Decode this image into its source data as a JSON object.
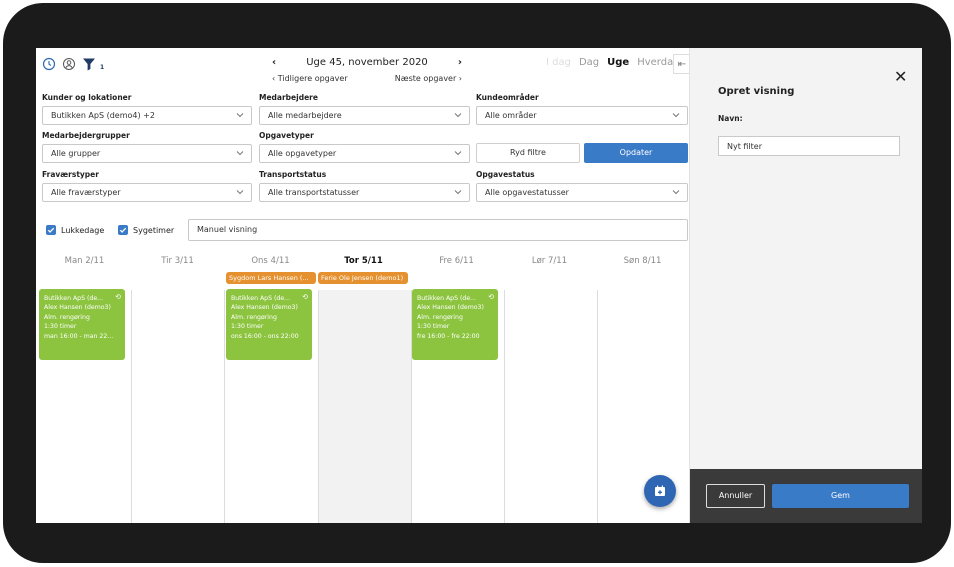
{
  "nav": {
    "week_title": "Uge 45, november 2020",
    "prev_arrow": "‹",
    "next_arrow": "›",
    "earlier": "‹  Tidligere opgaver",
    "later": "Næste opgaver  ›",
    "filter_count": "1"
  },
  "views": {
    "idag": "I dag",
    "dag": "Dag",
    "uge": "Uge",
    "hverdag": "Hverdag"
  },
  "filters": {
    "kunder_label": "Kunder og lokationer",
    "kunder_value": "Butikken ApS (demo4) +2",
    "medarbejdere_label": "Medarbejdere",
    "medarbejdere_value": "Alle medarbejdere",
    "kundeomraader_label": "Kundeområder",
    "kundeomraader_value": "Alle områder",
    "medarbejdergrupper_label": "Medarbejdergrupper",
    "medarbejdergrupper_value": "Alle grupper",
    "opgavetyper_label": "Opgavetyper",
    "opgavetyper_value": "Alle opgavetyper",
    "fravaerstyper_label": "Fraværstyper",
    "fravaerstyper_value": "Alle fraværstyper",
    "transportstatus_label": "Transportstatus",
    "transportstatus_value": "Alle transportstatusser",
    "opgavestatus_label": "Opgavestatus",
    "opgavestatus_value": "Alle opgavestatusser",
    "ryd_label": "Ryd filtre",
    "opdater_label": "Opdater"
  },
  "checks": {
    "lukkedage": "Lukkedage",
    "sygetimer": "Sygetimer",
    "manuel": "Manuel visning"
  },
  "days": [
    {
      "label": "Man 2/11"
    },
    {
      "label": "Tir 3/11"
    },
    {
      "label": "Ons 4/11"
    },
    {
      "label": "Tor 5/11"
    },
    {
      "label": "Fre 6/11"
    },
    {
      "label": "Lør 7/11"
    },
    {
      "label": "Søn 8/11"
    }
  ],
  "absences": [
    {
      "text": "Sygdom Lars Hansen (..."
    },
    {
      "text": "Ferie Ole Jensen (demo1)"
    }
  ],
  "events": [
    {
      "l1": "Butikken ApS (de...",
      "l2": "Alex Hansen (demo3)",
      "l3": "Alm. rengøring",
      "l4": "1:30 timer",
      "l5": "man 16:00 - man 22..."
    },
    {
      "l1": "Butikken ApS (de...",
      "l2": "Alex Hansen (demo3)",
      "l3": "Alm. rengøring",
      "l4": "1:30 timer",
      "l5": "ons 16:00 - ons 22:00"
    },
    {
      "l1": "Butikken ApS (de...",
      "l2": "Alex Hansen (demo3)",
      "l3": "Alm. rengøring",
      "l4": "1:30 timer",
      "l5": "fre 16:00 - fre 22:00"
    }
  ],
  "panel": {
    "title": "Opret visning",
    "name_label": "Navn:",
    "name_value": "Nyt filter",
    "cancel": "Annuller",
    "save": "Gem"
  },
  "colors": {
    "accent": "#3a7bc8",
    "event": "#8cc43f",
    "absence": "#e5912f",
    "fab": "#2f66b3"
  }
}
